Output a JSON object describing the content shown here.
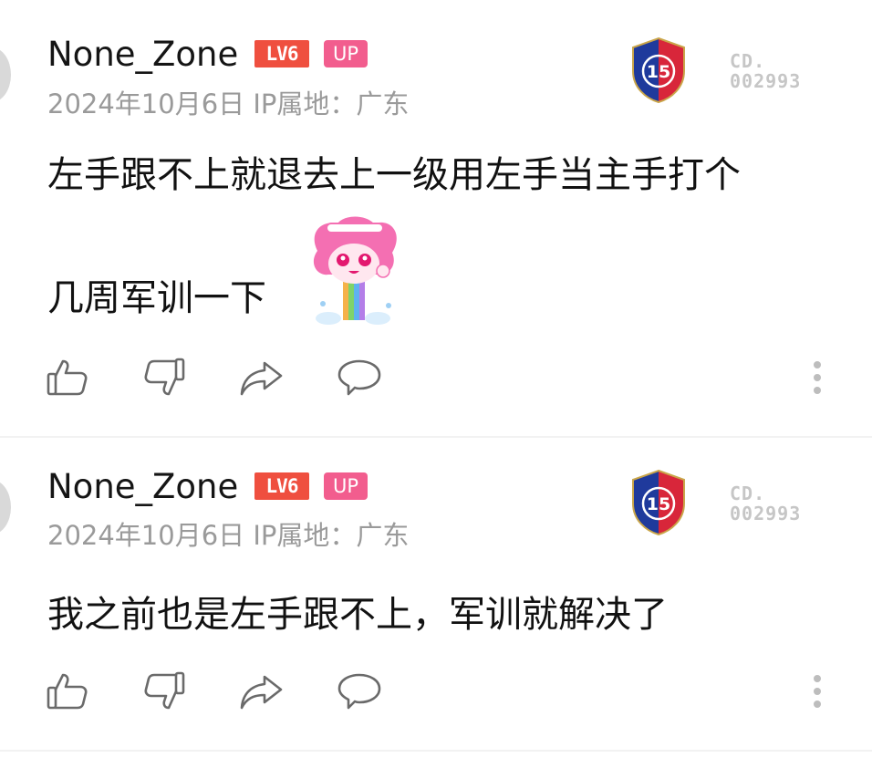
{
  "comments": [
    {
      "username": "None_Zone",
      "level_badge": "LV6",
      "up_badge": "UP",
      "meta": "2024年10月6日 IP属地：广东",
      "fan_number_line1": "CD.",
      "fan_number_line2": "002993",
      "fan_medal_number": "15",
      "body_line1": "左手跟不上就退去上一级用左手当主手打个",
      "body_line2": "几周军训一下",
      "has_sticker": true
    },
    {
      "username": "None_Zone",
      "level_badge": "LV6",
      "up_badge": "UP",
      "meta": "2024年10月6日 IP属地：广东",
      "fan_number_line1": "CD.",
      "fan_number_line2": "002993",
      "fan_medal_number": "15",
      "body_line1": "我之前也是左手跟不上，军训就解决了",
      "has_sticker": false
    }
  ],
  "icons": {
    "like": "thumbs-up-icon",
    "dislike": "thumbs-down-icon",
    "share": "share-arrow-icon",
    "reply": "speech-bubble-icon",
    "more": "vertical-dots-icon"
  },
  "colors": {
    "level_badge": "#ef4f3f",
    "up_badge": "#f25d8e",
    "meta_text": "#9a9a9a",
    "medal_blue": "#1f3a9c",
    "medal_red": "#d8263a"
  }
}
